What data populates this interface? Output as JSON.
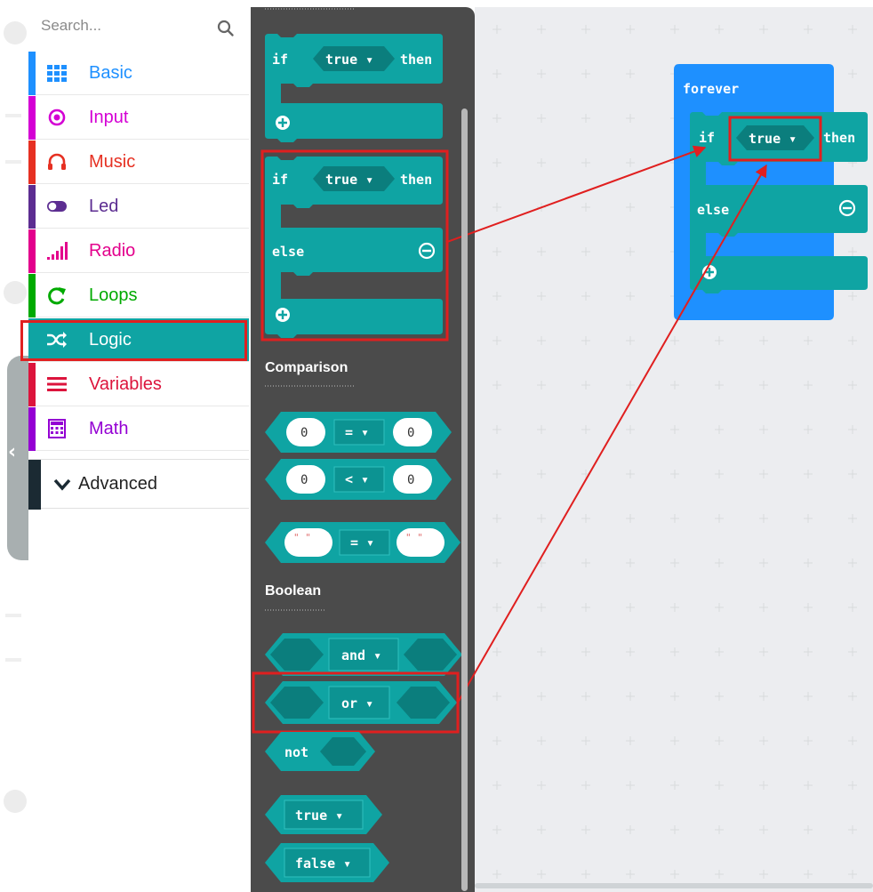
{
  "search": {
    "placeholder": "Search..."
  },
  "categories": [
    {
      "id": "basic",
      "label": "Basic",
      "color": "#1e90ff",
      "icon": "grid-icon"
    },
    {
      "id": "input",
      "label": "Input",
      "color": "#d400d4",
      "icon": "radio-target-icon"
    },
    {
      "id": "music",
      "label": "Music",
      "color": "#e63022",
      "icon": "headphones-icon"
    },
    {
      "id": "led",
      "label": "Led",
      "color": "#5c2d91",
      "icon": "toggle-icon"
    },
    {
      "id": "radio",
      "label": "Radio",
      "color": "#e3008c",
      "icon": "signal-bars-icon"
    },
    {
      "id": "loops",
      "label": "Loops",
      "color": "#00aa00",
      "icon": "loop-arrow-icon"
    },
    {
      "id": "logic",
      "label": "Logic",
      "color": "#00a4a6",
      "icon": "shuffle-icon",
      "selected": true
    },
    {
      "id": "variables",
      "label": "Variables",
      "color": "#dc143c",
      "icon": "lines-icon"
    },
    {
      "id": "math",
      "label": "Math",
      "color": "#9400d3",
      "icon": "calculator-icon"
    }
  ],
  "advanced": {
    "label": "Advanced",
    "color": "#1b2a33"
  },
  "flyout": {
    "if_then": {
      "if": "if",
      "cond": "true ▾",
      "then": "then"
    },
    "if_else": {
      "if": "if",
      "cond": "true ▾",
      "then": "then",
      "else": "else"
    },
    "comparison_heading": "Comparison",
    "compare_eq": {
      "left": "0",
      "op": "= ▾",
      "right": "0"
    },
    "compare_lt": {
      "left": "0",
      "op": "< ▾",
      "right": "0"
    },
    "compare_str": {
      "left": "\" \"",
      "op": "= ▾",
      "right": "\" \""
    },
    "boolean_heading": "Boolean",
    "and_op": "and ▾",
    "or_op": "or ▾",
    "not_label": "not",
    "true_label": "true ▾",
    "false_label": "false ▾"
  },
  "workspace": {
    "forever_label": "forever",
    "if": "if",
    "cond": "true ▾",
    "then": "then",
    "else": "else"
  },
  "colors": {
    "logic": "#0fa4a3",
    "logic_dark": "#0b7e7d",
    "forever": "#1e90ff",
    "flyout_bg": "#4b4b4b",
    "highlight": "#e01f1f"
  }
}
